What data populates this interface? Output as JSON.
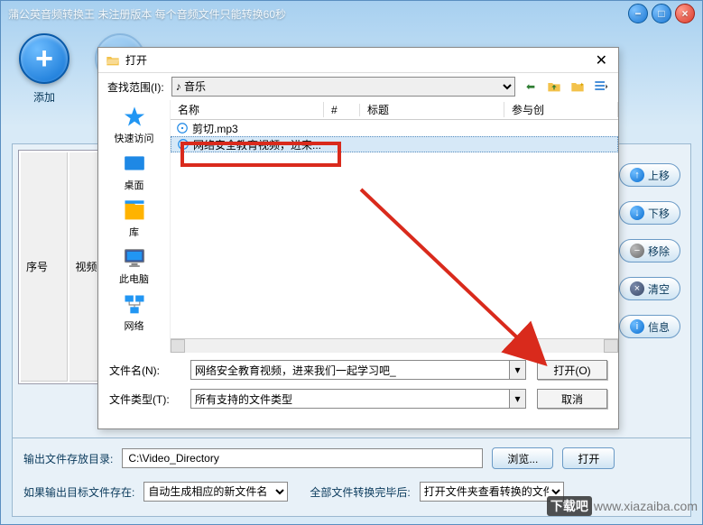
{
  "app": {
    "title": "蒲公英音频转换王 未注册版本 每个音频文件只能转换60秒",
    "toolbar": {
      "add": "添加"
    }
  },
  "main": {
    "table_cols": [
      "序号",
      "视频源"
    ],
    "side": {
      "up": "上移",
      "down": "下移",
      "remove": "移除",
      "clear": "清空",
      "info": "信息"
    }
  },
  "bottom": {
    "output_label": "输出文件存放目录:",
    "output_path": "C:\\Video_Directory",
    "browse": "浏览...",
    "open": "打开",
    "exists_label": "如果输出目标文件存在:",
    "exists_value": "自动生成相应的新文件名",
    "after_label": "全部文件转换完毕后:",
    "after_value": "打开文件夹查看转换的文件"
  },
  "dialog": {
    "title": "打开",
    "lookin_label": "查找范围(I):",
    "lookin_value": "音乐",
    "places": {
      "quick": "快速访问",
      "desktop": "桌面",
      "library": "库",
      "thispc": "此电脑",
      "network": "网络"
    },
    "cols": {
      "name": "名称",
      "num": "#",
      "title": "标题",
      "cred": "参与创"
    },
    "files": [
      {
        "name": "剪切.mp3",
        "selected": false
      },
      {
        "name": "网络安全教育视频，进来...",
        "selected": true
      }
    ],
    "filename_label": "文件名(N):",
    "filename_value": "网络安全教育视频，进来我们一起学习吧_",
    "filetype_label": "文件类型(T):",
    "filetype_value": "所有支持的文件类型",
    "open_btn": "打开(O)",
    "cancel_btn": "取消"
  },
  "watermark": {
    "brand": "下载吧",
    "url": "www.xiazaiba.com"
  }
}
